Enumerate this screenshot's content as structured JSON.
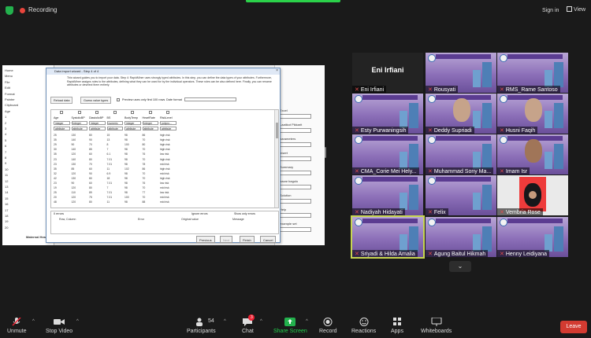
{
  "top": {
    "recording_label": "Recording",
    "sign_in": "Sign in",
    "view": "View"
  },
  "share": {
    "sidebar_rows": [
      "Home",
      "Menu",
      "File",
      "Edit",
      "Format",
      "Painter",
      "Clipboard",
      "Age",
      "1",
      "2",
      "3",
      "4",
      "5",
      "6",
      "7",
      "8",
      "9",
      "10",
      "11",
      "12",
      "13",
      "14",
      "15",
      "16",
      "17",
      "18",
      "19",
      "20"
    ],
    "sidebar_tab": "Maternal Hea",
    "right_labels": [
      "Excel",
      "Laatikot Pikkarit",
      "parameters",
      "Insert",
      "Summary",
      "bazar bagulu",
      "Solution",
      "Help",
      "example set"
    ],
    "dialog": {
      "title": "Data import wizard - Step 4 of 4",
      "description": "This wizard guides you to import your data. Step 4: RapidMiner uses strongly typed attributes. In this step, you can define the data types of your attributes. Furthermore, RapidMiner assigns roles to the attributes, defining what they can be used for by the individual operators. These roles can be also defined here. Finally, you can rename attributes or deselect them entirely.",
      "toolbar": {
        "reload": "Reload data",
        "guess": "Guess value types",
        "preview": "Preview uses only first 100 rows",
        "date_format": "Date format"
      },
      "columns": [
        {
          "name": "Age",
          "type": "integer",
          "role": "attribute"
        },
        {
          "name": "SystolicBP",
          "type": "integer",
          "role": "attribute"
        },
        {
          "name": "DiastolicBP",
          "type": "integer",
          "role": "attribute"
        },
        {
          "name": "BS",
          "type": "numeric",
          "role": "attribute"
        },
        {
          "name": "BodyTemp",
          "type": "integer",
          "role": "attribute"
        },
        {
          "name": "HeartRate",
          "type": "integer",
          "role": "attribute"
        },
        {
          "name": "RiskLevel",
          "type": "polyno...",
          "role": "attribute"
        }
      ],
      "rows": [
        [
          "25",
          "130",
          "80",
          "15",
          "98",
          "86",
          "high risk"
        ],
        [
          "35",
          "140",
          "90",
          "13",
          "98",
          "70",
          "high risk"
        ],
        [
          "29",
          "90",
          "70",
          "8",
          "100",
          "80",
          "high risk"
        ],
        [
          "30",
          "140",
          "85",
          "7",
          "98",
          "70",
          "high risk"
        ],
        [
          "35",
          "120",
          "60",
          "6.1",
          "98",
          "76",
          "low risk"
        ],
        [
          "23",
          "140",
          "80",
          "7.01",
          "98",
          "70",
          "high risk"
        ],
        [
          "23",
          "130",
          "70",
          "7.01",
          "98",
          "78",
          "mid risk"
        ],
        [
          "35",
          "85",
          "60",
          "11",
          "102",
          "86",
          "high risk"
        ],
        [
          "32",
          "120",
          "90",
          "6.9",
          "98",
          "70",
          "mid risk"
        ],
        [
          "42",
          "130",
          "80",
          "18",
          "98",
          "70",
          "high risk"
        ],
        [
          "23",
          "90",
          "60",
          "7.01",
          "98",
          "76",
          "low risk"
        ],
        [
          "19",
          "120",
          "80",
          "7",
          "98",
          "70",
          "mid risk"
        ],
        [
          "25",
          "110",
          "89",
          "7.01",
          "98",
          "77",
          "low risk"
        ],
        [
          "20",
          "120",
          "75",
          "7.01",
          "100",
          "70",
          "mid risk"
        ],
        [
          "48",
          "120",
          "80",
          "11",
          "98",
          "88",
          "mid risk"
        ]
      ],
      "errors_label": "0 errors",
      "ignore_errors": "Ignore errors",
      "show_only": "Show only errors",
      "error_headers": [
        "Row, Column",
        "Error",
        "Original value",
        "Message"
      ],
      "buttons": {
        "previous": "Previous",
        "next": "Next",
        "finish": "Finish",
        "cancel": "Cancel"
      }
    }
  },
  "participants": {
    "speaker_name": "Eni Irfiani",
    "tiles": [
      {
        "name": "Eni Irfiani"
      },
      {
        "name": "Rousyati"
      },
      {
        "name": "RMS_Rame Santoso"
      },
      {
        "name": "Esty Purwaningsih"
      },
      {
        "name": "Deddy Supriadi"
      },
      {
        "name": "Husni Faqih"
      },
      {
        "name": "CMA_Corie Mei Hely..."
      },
      {
        "name": "Muhammad Sony Ma..."
      },
      {
        "name": "Imam Isr"
      },
      {
        "name": "Nadiyah Hidayati"
      },
      {
        "name": "Felix"
      },
      {
        "name": "Vembria Rose"
      },
      {
        "name": "Sriyadi & Hilda Amalia"
      },
      {
        "name": "Agung Baitul Hikmah"
      },
      {
        "name": "Henny Leidiyana"
      }
    ]
  },
  "bottom": {
    "unmute": "Unmute",
    "stop_video": "Stop Video",
    "participants": "Participants",
    "participants_count": "54",
    "chat": "Chat",
    "chat_badge": "3",
    "share_screen": "Share Screen",
    "record": "Record",
    "reactions": "Reactions",
    "apps": "Apps",
    "whiteboards": "Whiteboards",
    "leave": "Leave",
    "caret": "^"
  },
  "colors": {
    "background": "#1a1a1a",
    "leave": "#d33b31",
    "share_green": "#23b14d",
    "record_red": "#e8453c",
    "active_speaker": "#c8d651"
  }
}
